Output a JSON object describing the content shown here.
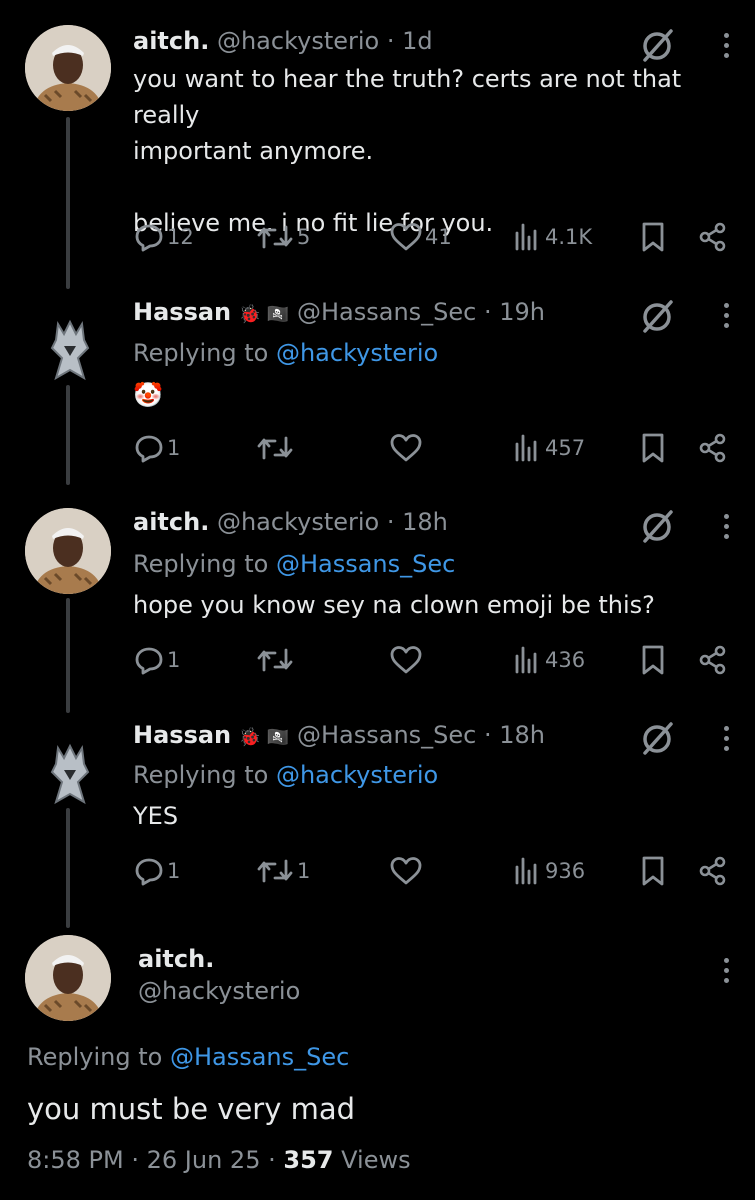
{
  "tweets": [
    {
      "name": "aitch.",
      "handle": "@hackysterio",
      "time": "· 1d",
      "replying_label": "",
      "replying_to": "",
      "text": "you want to hear the truth? certs are not that really\nimportant anymore.\n\nbelieve me. i no fit lie for you.",
      "replies": "12",
      "reposts": "5",
      "likes": "41",
      "views": "4.1K"
    },
    {
      "name": "Hassan",
      "name_emoji": "🐞 🏴‍☠️",
      "handle": "@Hassans_Sec",
      "time": "· 19h",
      "replying_label": "Replying to",
      "replying_to": "@hackysterio",
      "text": "🤡",
      "replies": "1",
      "reposts": "",
      "likes": "",
      "views": "457"
    },
    {
      "name": "aitch.",
      "handle": "@hackysterio",
      "time": "· 18h",
      "replying_label": "Replying to",
      "replying_to": "@Hassans_Sec",
      "text": "hope you know sey na clown emoji be this?",
      "replies": "1",
      "reposts": "",
      "likes": "",
      "views": "436"
    },
    {
      "name": "Hassan",
      "name_emoji": "🐞 🏴‍☠️",
      "handle": "@Hassans_Sec",
      "time": "· 18h",
      "replying_label": "Replying to",
      "replying_to": "@hackysterio",
      "text": "YES",
      "replies": "1",
      "reposts": "1",
      "likes": "",
      "views": "936"
    }
  ],
  "focused": {
    "name": "aitch.",
    "handle": "@hackysterio",
    "replying_label": "Replying to",
    "replying_to": "@Hassans_Sec",
    "text": "you must be very mad",
    "time": "8:58 PM",
    "date": "26 Jun 25",
    "views": "357",
    "views_label": "Views",
    "sep": "·"
  },
  "colors": {
    "background": "#000000",
    "text": "#e7e9ea",
    "muted": "#8b9197",
    "link": "#3f97e6",
    "thread_line": "#3a3d40"
  },
  "icons": [
    "reply-icon",
    "repost-icon",
    "like-icon",
    "views-icon",
    "bookmark-icon",
    "share-icon",
    "grok-icon",
    "more-icon"
  ]
}
